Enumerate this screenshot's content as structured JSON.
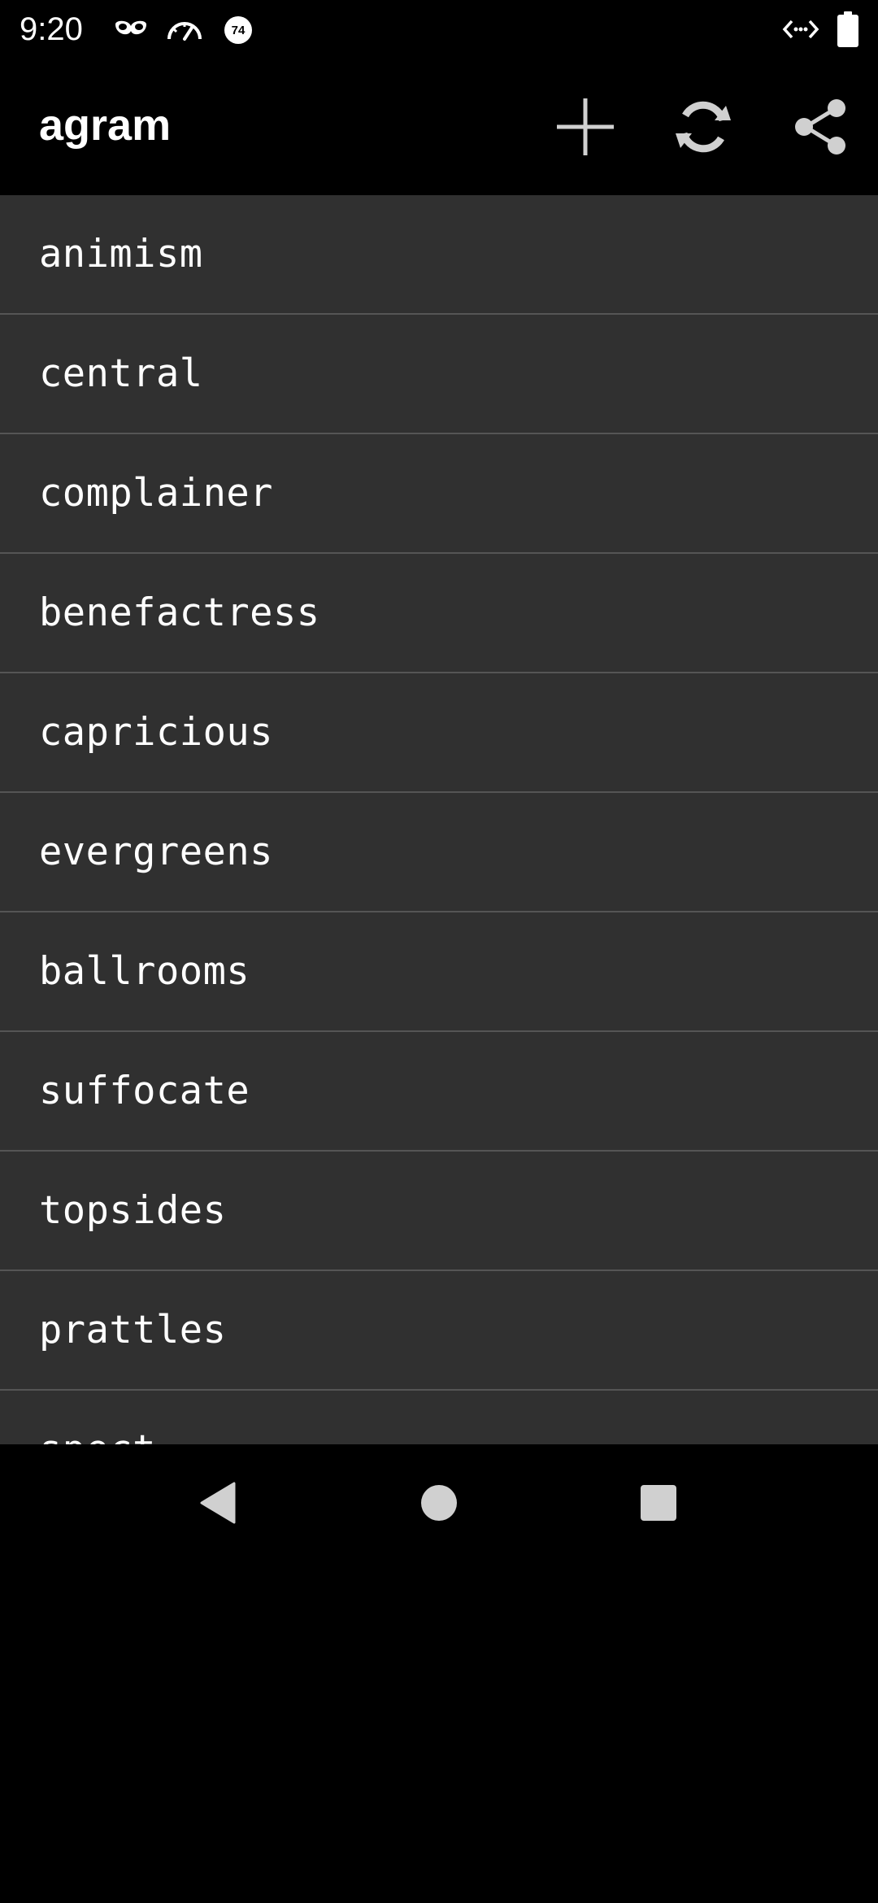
{
  "status_bar": {
    "time": "9:20",
    "badge_number": "74",
    "icons": [
      "incognito-mask-icon",
      "speedometer-icon",
      "badge-74-icon",
      "code-brackets-icon",
      "battery-icon"
    ]
  },
  "app_bar": {
    "title": "agram",
    "actions": [
      {
        "name": "add",
        "icon": "plus-icon"
      },
      {
        "name": "refresh",
        "icon": "refresh-icon"
      },
      {
        "name": "share",
        "icon": "share-icon"
      }
    ]
  },
  "list": {
    "items": [
      "animism",
      "central",
      "complainer",
      "benefactress",
      "capricious",
      "evergreens",
      "ballrooms",
      "suffocate",
      "topsides",
      "prattles",
      "spect"
    ]
  },
  "nav_bar": {
    "buttons": [
      {
        "name": "back",
        "icon": "back-triangle-icon"
      },
      {
        "name": "home",
        "icon": "home-circle-icon"
      },
      {
        "name": "recents",
        "icon": "recents-square-icon"
      }
    ]
  },
  "colors": {
    "background": "#000000",
    "list_background": "#303030",
    "divider": "#555555",
    "text": "#ffffff",
    "icon": "#d0d0d0"
  }
}
